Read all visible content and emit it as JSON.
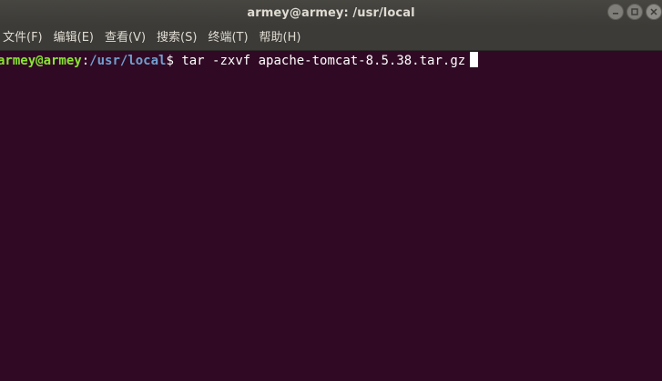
{
  "window": {
    "title": "armey@armey: /usr/local"
  },
  "menu": {
    "items": [
      {
        "label": "文件(F)"
      },
      {
        "label": "编辑(E)"
      },
      {
        "label": "查看(V)"
      },
      {
        "label": "搜索(S)"
      },
      {
        "label": "终端(T)"
      },
      {
        "label": "帮助(H)"
      }
    ]
  },
  "terminal": {
    "prompt_user": "armey@armey",
    "prompt_sep": ":",
    "prompt_path": "/usr/local",
    "prompt_symbol": "$",
    "command": " tar -zxvf apache-tomcat-8.5.38.tar.gz"
  },
  "colors": {
    "background": "#300a24",
    "prompt_user": "#8ae234",
    "prompt_path": "#729fcf",
    "titlebar": "#3c3b37"
  },
  "icons": {
    "minimize": "minimize-icon",
    "maximize": "maximize-icon",
    "close": "close-icon"
  }
}
